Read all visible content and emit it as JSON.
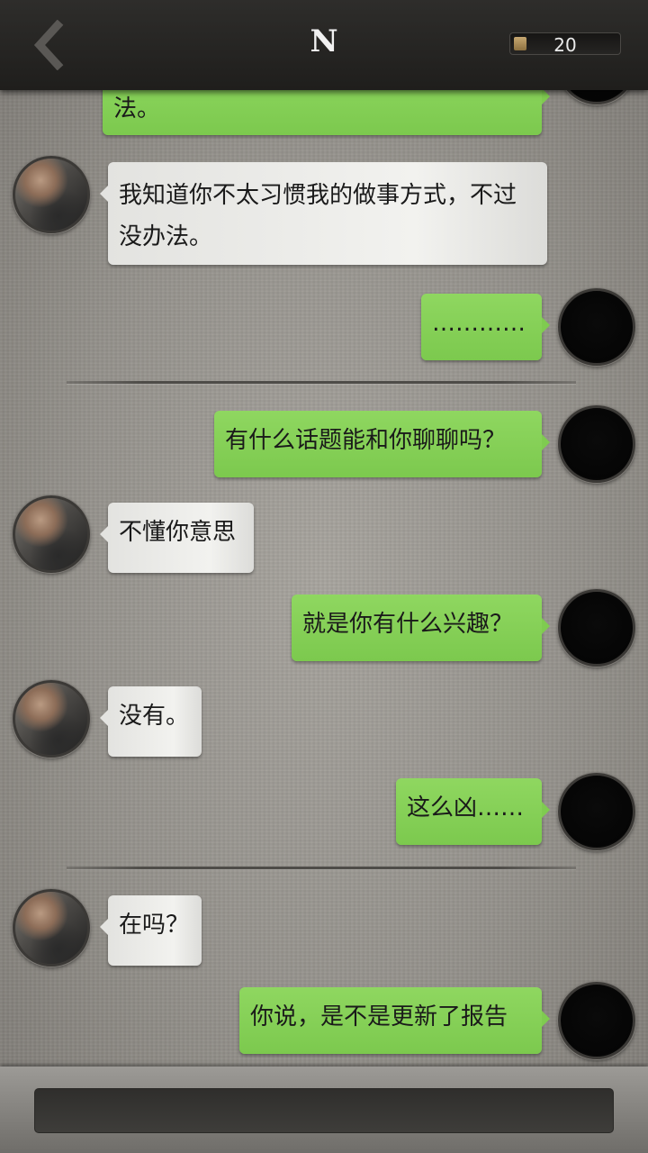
{
  "header": {
    "title": "N",
    "counter": "20"
  },
  "messages": [
    {
      "from": "self",
      "text": "法。"
    },
    {
      "from": "contact",
      "text": "我知道你不太习惯我的做事方式，不过没办法。"
    },
    {
      "from": "self",
      "text": "…………"
    },
    {
      "from": "self",
      "text": "有什么话题能和你聊聊吗？"
    },
    {
      "from": "contact",
      "text": "不懂你意思"
    },
    {
      "from": "self",
      "text": "就是你有什么兴趣？"
    },
    {
      "from": "contact",
      "text": "没有。"
    },
    {
      "from": "self",
      "text": "这么凶……"
    },
    {
      "from": "contact",
      "text": "在吗？"
    },
    {
      "from": "self",
      "text": "你说，是不是更新了报告"
    }
  ],
  "input": {
    "value": ""
  },
  "icons": {
    "back": "chevron-left-icon"
  }
}
